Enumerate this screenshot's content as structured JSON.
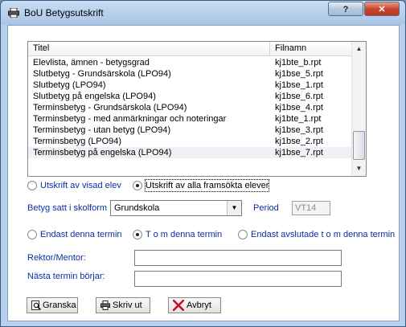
{
  "window": {
    "title": "BoU Betygsutskrift",
    "help_label": "?",
    "close_label": "✕"
  },
  "list": {
    "columns": [
      "Titel",
      "Filnamn"
    ],
    "rows": [
      {
        "title": "Elevlista, ämnen - betygsgrad",
        "file": "kj1bte_b.rpt"
      },
      {
        "title": "Slutbetyg - Grundsärskola (LPO94)",
        "file": "kj1bse_5.rpt"
      },
      {
        "title": "Slutbetyg (LPO94)",
        "file": "kj1bse_1.rpt"
      },
      {
        "title": "Slutbetyg på engelska (LPO94)",
        "file": "kj1bse_6.rpt"
      },
      {
        "title": "Terminsbetyg - Grundsärskola (LPO94)",
        "file": "kj1bse_4.rpt"
      },
      {
        "title": "Terminsbetyg - med anmärkningar och noteringar",
        "file": "kj1bte_1.rpt"
      },
      {
        "title": "Terminsbetyg - utan betyg (LPO94)",
        "file": "kj1bse_3.rpt"
      },
      {
        "title": "Terminsbetyg (LPO94)",
        "file": "kj1bse_2.rpt"
      },
      {
        "title": "Terminsbetyg på engelska (LPO94)",
        "file": "kj1bse_7.rpt"
      }
    ],
    "selected_index": 8
  },
  "print_scope": {
    "option_single": "Utskrift av visad elev",
    "option_all": "Utskrift av alla framsökta elever",
    "selected": "all"
  },
  "school_form": {
    "label": "Betyg satt i skolform",
    "value": "Grundskola",
    "period_label": "Period",
    "period_value": "VT14"
  },
  "term_scope": {
    "option_only": "Endast denna termin",
    "option_through": "T o m  denna termin",
    "option_finished": "Endast avslutade t o m denna termin",
    "selected": "through"
  },
  "fields": {
    "rektor_label": "Rektor/Mentor:",
    "rektor_value": "",
    "next_term_label": "Nästa termin börjar:",
    "next_term_value": ""
  },
  "buttons": {
    "preview": "Granska",
    "print": "Skriv ut",
    "cancel": "Avbryt"
  },
  "colors": {
    "label_blue": "#0a2ea5",
    "cancel_red": "#c8102e"
  }
}
